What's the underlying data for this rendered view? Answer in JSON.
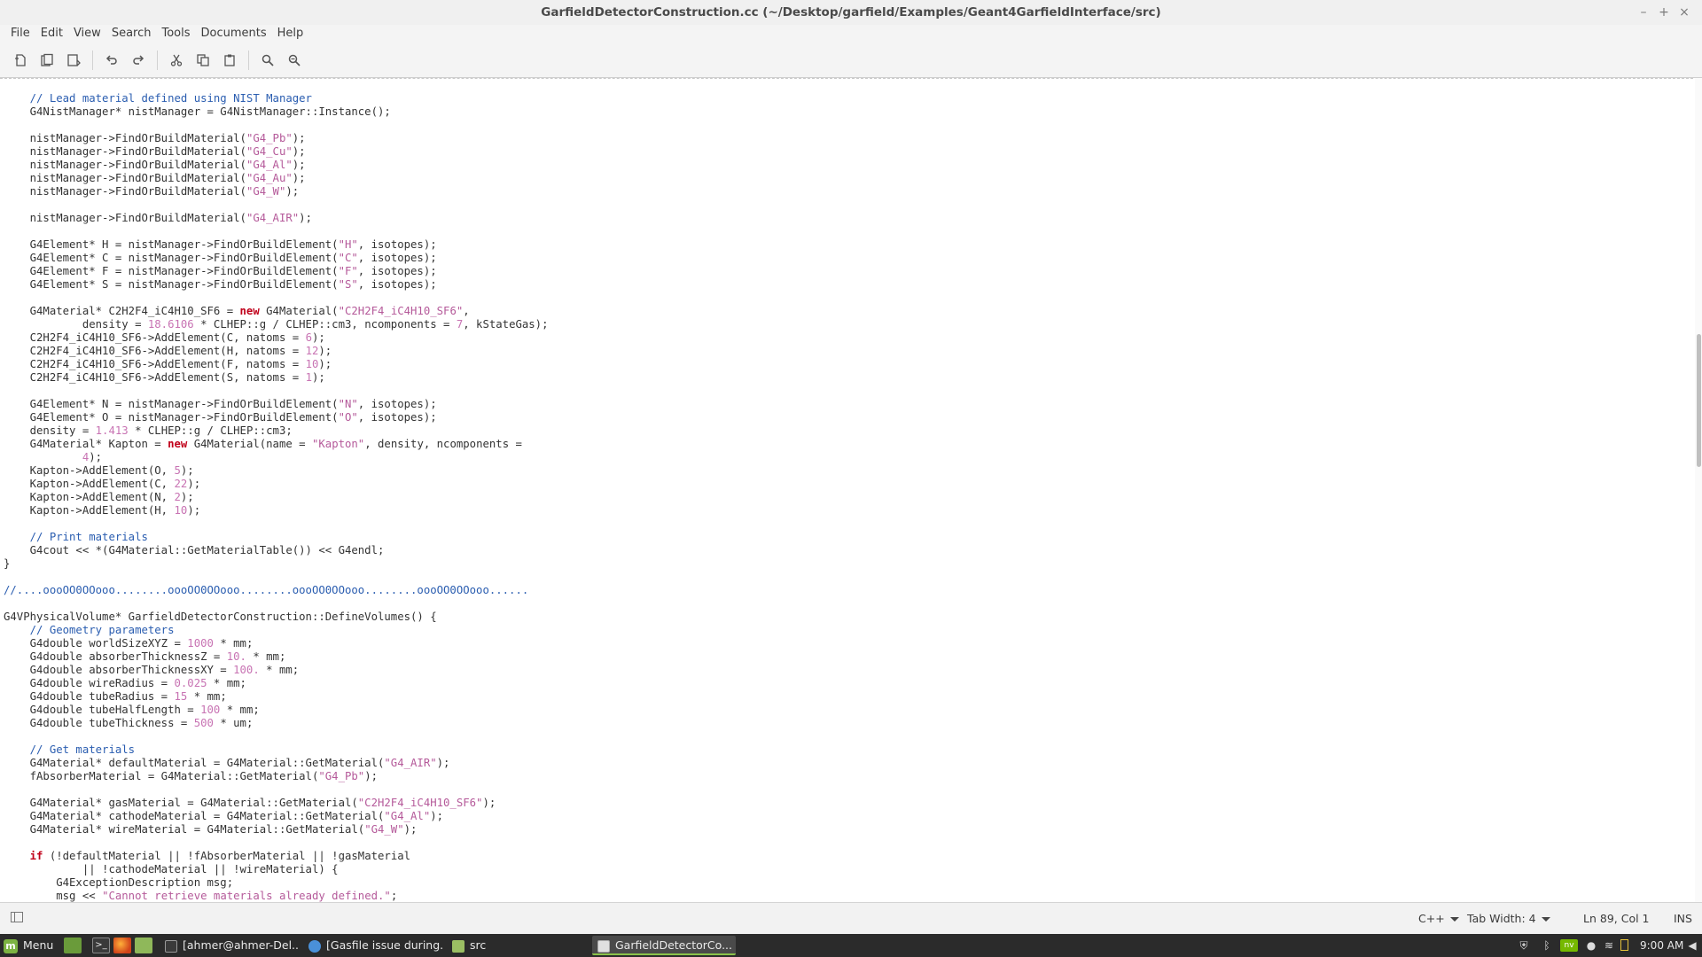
{
  "window": {
    "title": "GarfieldDetectorConstruction.cc (~/Desktop/garfield/Examples/Geant4GarfieldInterface/src)",
    "minimize": "–",
    "maximize": "+",
    "close": "×"
  },
  "menubar": {
    "items": [
      "File",
      "Edit",
      "View",
      "Search",
      "Tools",
      "Documents",
      "Help"
    ]
  },
  "toolbar": {
    "buttons": [
      "new-icon",
      "open-icon",
      "save-icon",
      "undo-icon",
      "redo-icon",
      "cut-icon",
      "copy-icon",
      "paste-icon",
      "search-icon",
      "search-replace-icon"
    ]
  },
  "editor": {
    "lines": [
      [
        [
          "c",
          "    // Lead material defined using NIST Manager"
        ]
      ],
      [
        [
          "t",
          "    G4NistManager* nistManager = G4NistManager::Instance();"
        ]
      ],
      [],
      [
        [
          "t",
          "    nistManager->FindOrBuildMaterial("
        ],
        [
          "s",
          "\"G4_Pb\""
        ],
        [
          "t",
          ");"
        ]
      ],
      [
        [
          "t",
          "    nistManager->FindOrBuildMaterial("
        ],
        [
          "s",
          "\"G4_Cu\""
        ],
        [
          "t",
          ");"
        ]
      ],
      [
        [
          "t",
          "    nistManager->FindOrBuildMaterial("
        ],
        [
          "s",
          "\"G4_Al\""
        ],
        [
          "t",
          ");"
        ]
      ],
      [
        [
          "t",
          "    nistManager->FindOrBuildMaterial("
        ],
        [
          "s",
          "\"G4_Au\""
        ],
        [
          "t",
          ");"
        ]
      ],
      [
        [
          "t",
          "    nistManager->FindOrBuildMaterial("
        ],
        [
          "s",
          "\"G4_W\""
        ],
        [
          "t",
          ");"
        ]
      ],
      [],
      [
        [
          "t",
          "    nistManager->FindOrBuildMaterial("
        ],
        [
          "s",
          "\"G4_AIR\""
        ],
        [
          "t",
          ");"
        ]
      ],
      [],
      [
        [
          "t",
          "    G4Element* H = nistManager->FindOrBuildElement("
        ],
        [
          "s",
          "\"H\""
        ],
        [
          "t",
          ", isotopes);"
        ]
      ],
      [
        [
          "t",
          "    G4Element* C = nistManager->FindOrBuildElement("
        ],
        [
          "s",
          "\"C\""
        ],
        [
          "t",
          ", isotopes);"
        ]
      ],
      [
        [
          "t",
          "    G4Element* F = nistManager->FindOrBuildElement("
        ],
        [
          "s",
          "\"F\""
        ],
        [
          "t",
          ", isotopes);"
        ]
      ],
      [
        [
          "t",
          "    G4Element* S = nistManager->FindOrBuildElement("
        ],
        [
          "s",
          "\"S\""
        ],
        [
          "t",
          ", isotopes);"
        ]
      ],
      [],
      [
        [
          "t",
          "    G4Material* C2H2F4_iC4H10_SF6 = "
        ],
        [
          "k",
          "new"
        ],
        [
          "t",
          " G4Material("
        ],
        [
          "s",
          "\"C2H2F4_iC4H10_SF6\""
        ],
        [
          "t",
          ","
        ]
      ],
      [
        [
          "t",
          "            density = "
        ],
        [
          "n",
          "18.6106"
        ],
        [
          "t",
          " * CLHEP::g / CLHEP::cm3, ncomponents = "
        ],
        [
          "n",
          "7"
        ],
        [
          "t",
          ", kStateGas);"
        ]
      ],
      [
        [
          "t",
          "    C2H2F4_iC4H10_SF6->AddElement(C, natoms = "
        ],
        [
          "n",
          "6"
        ],
        [
          "t",
          ");"
        ]
      ],
      [
        [
          "t",
          "    C2H2F4_iC4H10_SF6->AddElement(H, natoms = "
        ],
        [
          "n",
          "12"
        ],
        [
          "t",
          ");"
        ]
      ],
      [
        [
          "t",
          "    C2H2F4_iC4H10_SF6->AddElement(F, natoms = "
        ],
        [
          "n",
          "10"
        ],
        [
          "t",
          ");"
        ]
      ],
      [
        [
          "t",
          "    C2H2F4_iC4H10_SF6->AddElement(S, natoms = "
        ],
        [
          "n",
          "1"
        ],
        [
          "t",
          ");"
        ]
      ],
      [],
      [
        [
          "t",
          "    G4Element* N = nistManager->FindOrBuildElement("
        ],
        [
          "s",
          "\"N\""
        ],
        [
          "t",
          ", isotopes);"
        ]
      ],
      [
        [
          "t",
          "    G4Element* O = nistManager->FindOrBuildElement("
        ],
        [
          "s",
          "\"O\""
        ],
        [
          "t",
          ", isotopes);"
        ]
      ],
      [
        [
          "t",
          "    density = "
        ],
        [
          "n",
          "1.413"
        ],
        [
          "t",
          " * CLHEP::g / CLHEP::cm3;"
        ]
      ],
      [
        [
          "t",
          "    G4Material* Kapton = "
        ],
        [
          "k",
          "new"
        ],
        [
          "t",
          " G4Material(name = "
        ],
        [
          "s",
          "\"Kapton\""
        ],
        [
          "t",
          ", density, ncomponents ="
        ]
      ],
      [
        [
          "t",
          "            "
        ],
        [
          "n",
          "4"
        ],
        [
          "t",
          ");"
        ]
      ],
      [
        [
          "t",
          "    Kapton->AddElement(O, "
        ],
        [
          "n",
          "5"
        ],
        [
          "t",
          ");"
        ]
      ],
      [
        [
          "t",
          "    Kapton->AddElement(C, "
        ],
        [
          "n",
          "22"
        ],
        [
          "t",
          ");"
        ]
      ],
      [
        [
          "t",
          "    Kapton->AddElement(N, "
        ],
        [
          "n",
          "2"
        ],
        [
          "t",
          ");"
        ]
      ],
      [
        [
          "t",
          "    Kapton->AddElement(H, "
        ],
        [
          "n",
          "10"
        ],
        [
          "t",
          ");"
        ]
      ],
      [],
      [
        [
          "c",
          "    // Print materials"
        ]
      ],
      [
        [
          "t",
          "    G4cout << *(G4Material::GetMaterialTable()) << G4endl;"
        ]
      ],
      [
        [
          "t",
          "}"
        ]
      ],
      [],
      [
        [
          "c",
          "//....oooOO0OOooo........oooOO0OOooo........oooOO0OOooo........oooOO0OOooo......"
        ]
      ],
      [],
      [
        [
          "t",
          "G4VPhysicalVolume* GarfieldDetectorConstruction::DefineVolumes() {"
        ]
      ],
      [
        [
          "c",
          "    // Geometry parameters"
        ]
      ],
      [
        [
          "t",
          "    G4double worldSizeXYZ = "
        ],
        [
          "n",
          "1000"
        ],
        [
          "t",
          " * mm;"
        ]
      ],
      [
        [
          "t",
          "    G4double absorberThicknessZ = "
        ],
        [
          "n",
          "10."
        ],
        [
          "t",
          " * mm;"
        ]
      ],
      [
        [
          "t",
          "    G4double absorberThicknessXY = "
        ],
        [
          "n",
          "100."
        ],
        [
          "t",
          " * mm;"
        ]
      ],
      [
        [
          "t",
          "    G4double wireRadius = "
        ],
        [
          "n",
          "0.025"
        ],
        [
          "t",
          " * mm;"
        ]
      ],
      [
        [
          "t",
          "    G4double tubeRadius = "
        ],
        [
          "n",
          "15"
        ],
        [
          "t",
          " * mm;"
        ]
      ],
      [
        [
          "t",
          "    G4double tubeHalfLength = "
        ],
        [
          "n",
          "100"
        ],
        [
          "t",
          " * mm;"
        ]
      ],
      [
        [
          "t",
          "    G4double tubeThickness = "
        ],
        [
          "n",
          "500"
        ],
        [
          "t",
          " * um;"
        ]
      ],
      [],
      [
        [
          "c",
          "    // Get materials"
        ]
      ],
      [
        [
          "t",
          "    G4Material* defaultMaterial = G4Material::GetMaterial("
        ],
        [
          "s",
          "\"G4_AIR\""
        ],
        [
          "t",
          ");"
        ]
      ],
      [
        [
          "t",
          "    fAbsorberMaterial = G4Material::GetMaterial("
        ],
        [
          "s",
          "\"G4_Pb\""
        ],
        [
          "t",
          ");"
        ]
      ],
      [],
      [
        [
          "t",
          "    G4Material* gasMaterial = G4Material::GetMaterial("
        ],
        [
          "s",
          "\"C2H2F4_iC4H10_SF6\""
        ],
        [
          "t",
          ");"
        ]
      ],
      [
        [
          "t",
          "    G4Material* cathodeMaterial = G4Material::GetMaterial("
        ],
        [
          "s",
          "\"G4_Al\""
        ],
        [
          "t",
          ");"
        ]
      ],
      [
        [
          "t",
          "    G4Material* wireMaterial = G4Material::GetMaterial("
        ],
        [
          "s",
          "\"G4_W\""
        ],
        [
          "t",
          ");"
        ]
      ],
      [],
      [
        [
          "t",
          "    "
        ],
        [
          "k",
          "if"
        ],
        [
          "t",
          " (!defaultMaterial || !fAbsorberMaterial || !gasMaterial"
        ]
      ],
      [
        [
          "t",
          "            || !cathodeMaterial || !wireMaterial) {"
        ]
      ],
      [
        [
          "t",
          "        G4ExceptionDescription msg;"
        ]
      ],
      [
        [
          "t",
          "        msg << "
        ],
        [
          "s",
          "\"Cannot retrieve materials already defined.\""
        ],
        [
          "t",
          ";"
        ]
      ]
    ],
    "scroll_position": 0.37
  },
  "statusbar": {
    "language": "C++",
    "tab_width": "Tab Width: 4",
    "cursor": "Ln 89, Col 1",
    "mode": "INS"
  },
  "taskbar": {
    "menu_label": "Menu",
    "tasks": [
      {
        "label": "[ahmer@ahmer-Del...",
        "icon": "terminal-icon",
        "active": false
      },
      {
        "label": "[Gasfile issue during...",
        "icon": "browser-icon",
        "active": false
      },
      {
        "label": "src",
        "icon": "folder-icon",
        "active": false
      },
      {
        "label": "GarfieldDetectorCo...",
        "icon": "text-editor-icon",
        "active": true
      }
    ],
    "clock": "9:00 AM"
  }
}
